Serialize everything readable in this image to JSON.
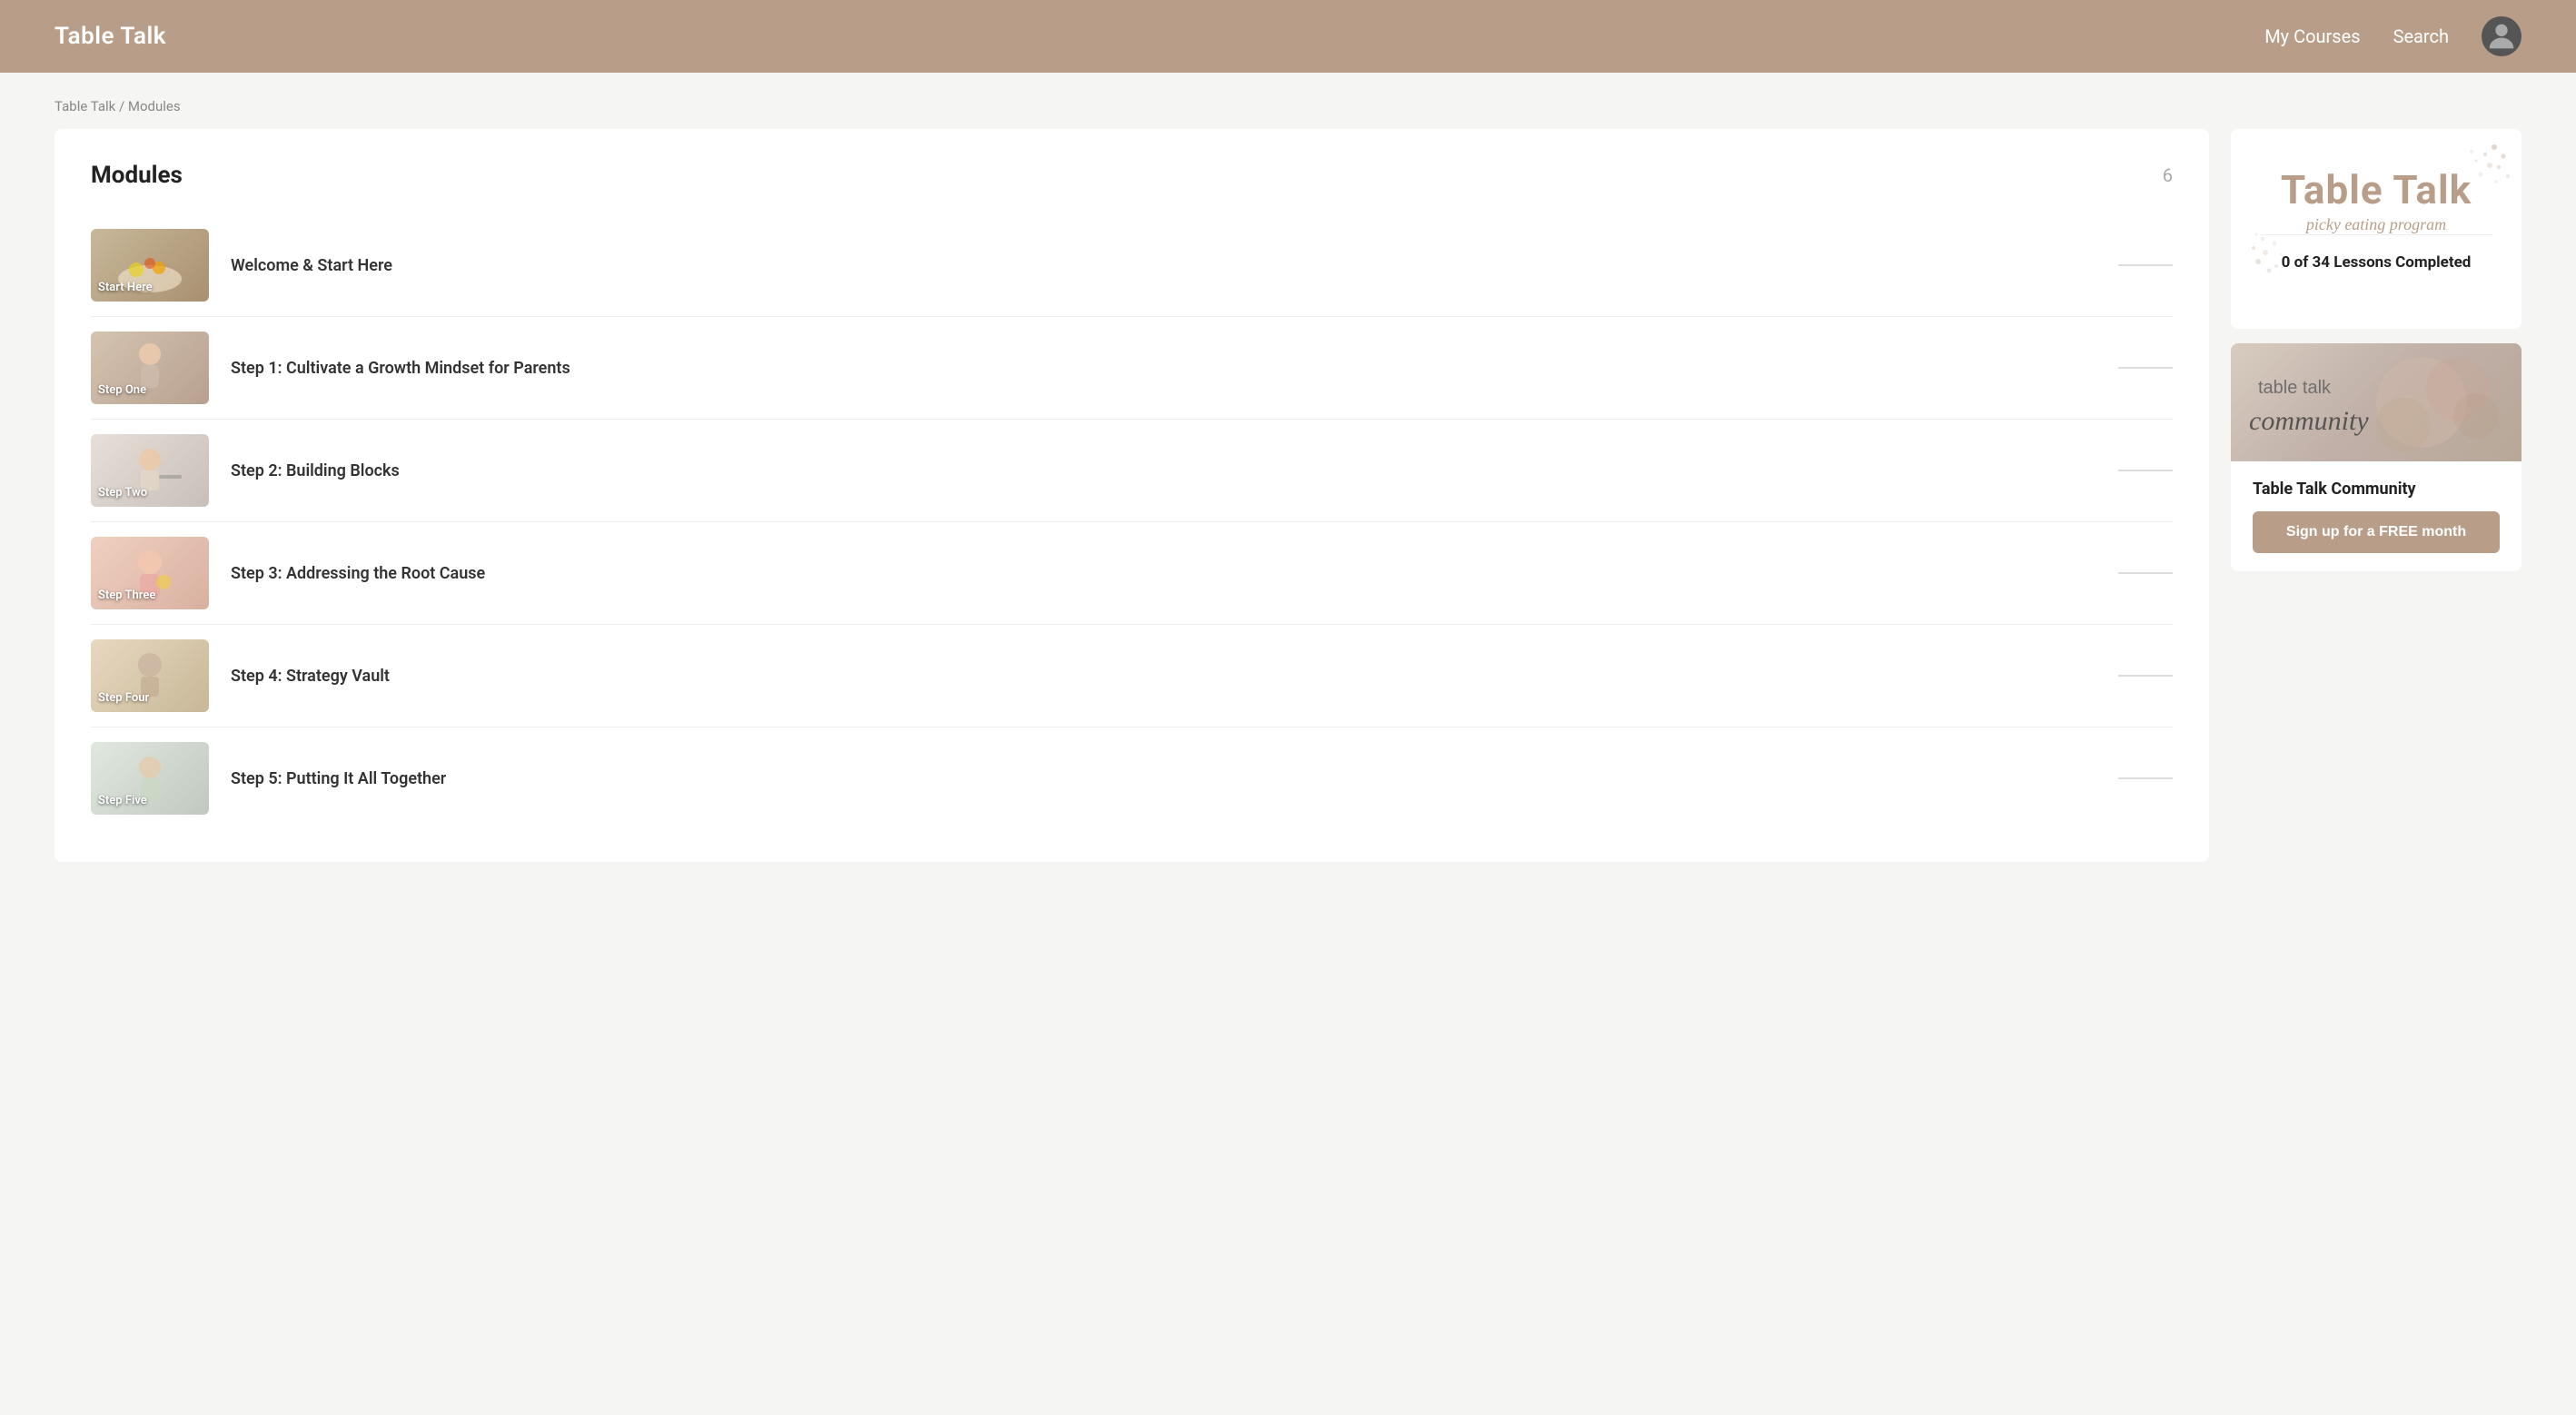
{
  "header": {
    "logo": "Table Talk",
    "nav": {
      "my_courses": "My Courses",
      "search": "Search"
    }
  },
  "breadcrumb": {
    "root": "Table Talk",
    "separator": " / ",
    "current": "Modules"
  },
  "modules_panel": {
    "title": "Modules",
    "count": "6",
    "items": [
      {
        "id": "welcome",
        "thumbnail_label": "Start Here",
        "name": "Welcome & Start Here",
        "thumb_class": "thumb-start-here"
      },
      {
        "id": "step1",
        "thumbnail_label": "Step One",
        "name": "Step 1: Cultivate a Growth Mindset for Parents",
        "thumb_class": "thumb-step-one"
      },
      {
        "id": "step2",
        "thumbnail_label": "Step Two",
        "name": "Step 2: Building Blocks",
        "thumb_class": "thumb-step-two"
      },
      {
        "id": "step3",
        "thumbnail_label": "Step Three",
        "name": "Step 3: Addressing the Root Cause",
        "thumb_class": "thumb-step-three"
      },
      {
        "id": "step4",
        "thumbnail_label": "Step Four",
        "name": "Step 4: Strategy Vault",
        "thumb_class": "thumb-step-four"
      },
      {
        "id": "step5",
        "thumbnail_label": "Step Five",
        "name": "Step 5: Putting It All Together",
        "thumb_class": "thumb-step-five"
      }
    ]
  },
  "sidebar": {
    "logo_card": {
      "main_text": "Table Talk",
      "sub_text": "picky eating program",
      "lessons": "0 of 34 Lessons Completed"
    },
    "community_card": {
      "image_text_plain": "table talk",
      "image_text_cursive": "community",
      "title": "Table Talk Community",
      "signup_btn": "Sign up for a FREE month"
    }
  }
}
